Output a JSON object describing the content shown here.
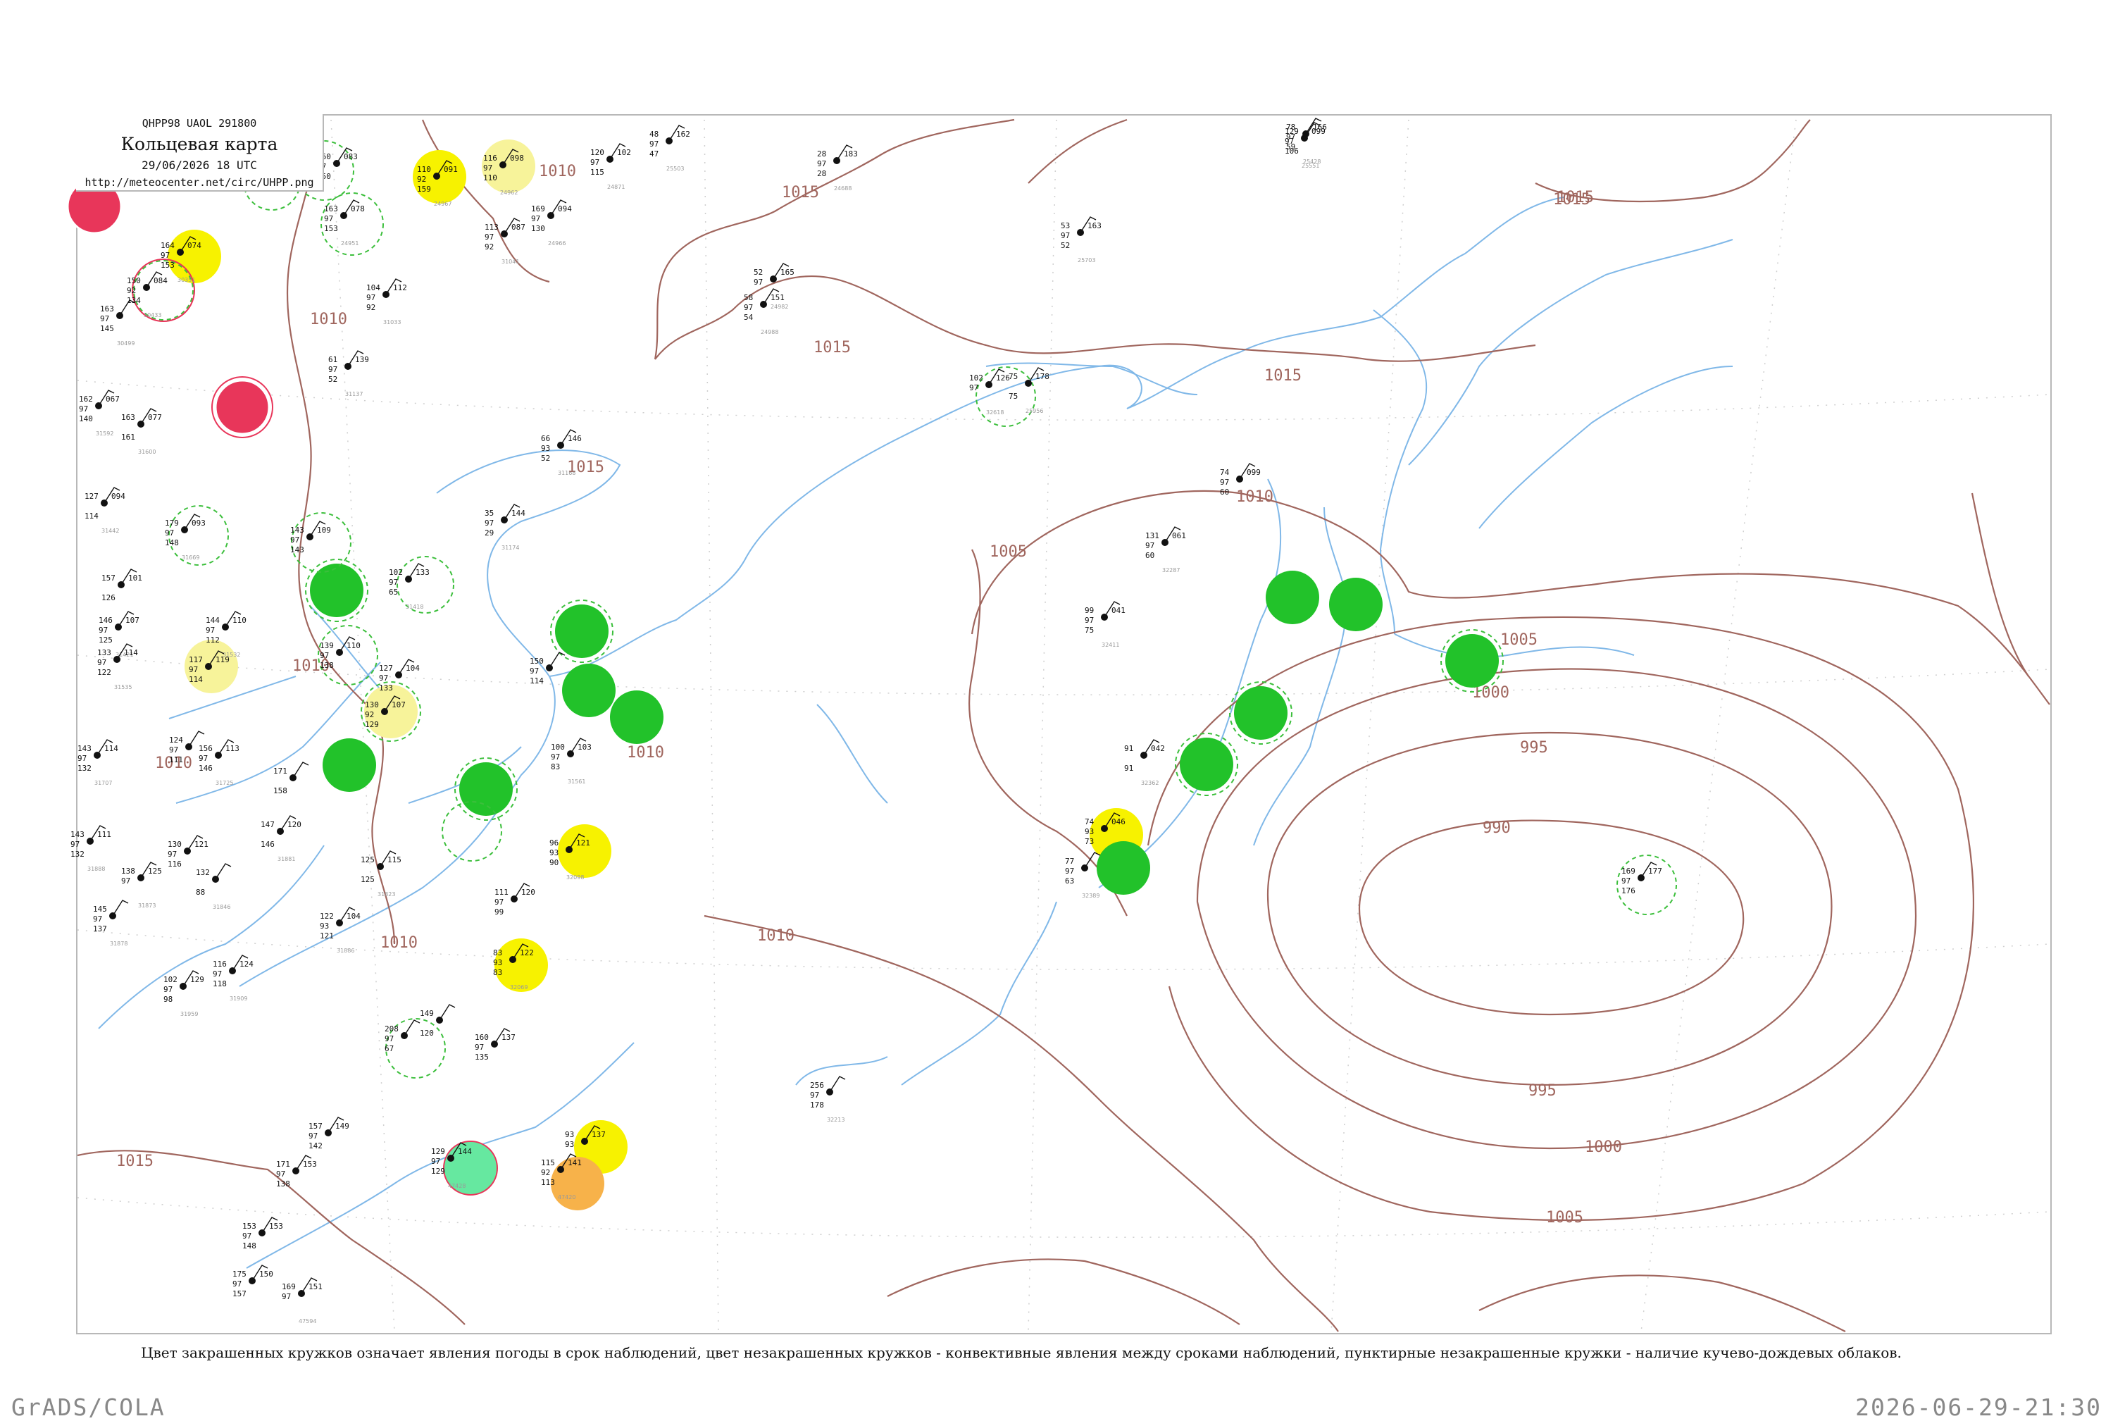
{
  "header": {
    "code": "QHPP98  UAOL  291800",
    "title": "Кольцевая карта",
    "date": "29/06/2026 18 UTC",
    "url": "http://meteocenter.net/circ/UHPP.png"
  },
  "caption": "Цвет закрашенных кружков означает явления погоды в срок наблюдений, цвет незакрашенных кружков - конвективные явления между сроками наблюдений, пунктирные незакрашенные кружки - наличие кучево-дождевых облаков.",
  "footer": {
    "left": "GrADS/COLA",
    "right": "2026-06-29-21:30"
  },
  "colors": {
    "isobar": "#a0665e",
    "coast": "#80b8e8",
    "frame": "#b8b8b8",
    "green": "#22c22a",
    "yellow": "#f7f200",
    "light_yellow": "#f7f39a",
    "red": "#e8365a",
    "orange": "#f7b24a",
    "teal": "#66e8a0"
  },
  "isobar_labels": [
    {
      "text": "1015"
    },
    {
      "text": "1015"
    },
    {
      "text": "1015"
    },
    {
      "text": "1015"
    },
    {
      "text": "1015"
    },
    {
      "text": "1015"
    },
    {
      "text": "1010"
    },
    {
      "text": "1010"
    },
    {
      "text": "1010"
    },
    {
      "text": "1010"
    },
    {
      "text": "1010"
    },
    {
      "text": "1010"
    },
    {
      "text": "1005"
    },
    {
      "text": "1005"
    },
    {
      "text": "1005"
    },
    {
      "text": "1000"
    },
    {
      "text": "1000"
    },
    {
      "text": "995"
    },
    {
      "text": "995"
    },
    {
      "text": "990"
    },
    {
      "text": "1010"
    },
    {
      "text": "1010"
    },
    {
      "text": "1015"
    }
  ],
  "stations": [
    {
      "id": "1",
      "t": "160",
      "p": "083",
      "v": "97",
      "w": "150",
      "wmo": ""
    },
    {
      "id": "2",
      "t": "110",
      "p": "091",
      "v": "92",
      "w": "159",
      "wmo": "24967"
    },
    {
      "id": "3",
      "t": "116",
      "p": "098",
      "v": "97",
      "w": "110",
      "wmo": "24962"
    },
    {
      "id": "4",
      "t": "120",
      "p": "102",
      "v": "97",
      "w": "115",
      "wmo": "24871"
    },
    {
      "id": "5",
      "t": "163",
      "p": "078",
      "v": "97",
      "w": "153",
      "wmo": "24951"
    },
    {
      "id": "6",
      "t": "169",
      "p": "094",
      "v": "97",
      "w": "130",
      "wmo": "24966"
    },
    {
      "id": "7",
      "t": "113",
      "p": "087",
      "v": "97",
      "w": "92",
      "wmo": "31041"
    },
    {
      "id": "8",
      "t": "164",
      "p": "074",
      "v": "97",
      "w": "153",
      "wmo": "30351"
    },
    {
      "id": "9",
      "t": "150",
      "p": "084",
      "v": "92",
      "w": "134",
      "wmo": "30433"
    },
    {
      "id": "10",
      "t": "163",
      "p": "",
      "v": "97",
      "w": "145",
      "wmo": "30499"
    },
    {
      "id": "11",
      "t": "104",
      "p": "112",
      "v": "97",
      "w": "92",
      "wmo": "31033"
    },
    {
      "id": "12",
      "t": "61",
      "p": "139",
      "v": "97",
      "w": "52",
      "wmo": "31137"
    },
    {
      "id": "13",
      "t": "162",
      "p": "067",
      "v": "97",
      "w": "140",
      "wmo": "31592"
    },
    {
      "id": "14",
      "t": "163",
      "p": "077",
      "v": "",
      "w": "161",
      "wmo": "31600"
    },
    {
      "id": "15",
      "t": "66",
      "p": "146",
      "v": "93",
      "w": "52",
      "wmo": "31168"
    },
    {
      "id": "16",
      "t": "127",
      "p": "094",
      "v": "",
      "w": "114",
      "wmo": "31442"
    },
    {
      "id": "17",
      "t": "179",
      "p": "093",
      "v": "97",
      "w": "148",
      "wmo": "31669"
    },
    {
      "id": "18",
      "t": "143",
      "p": "109",
      "v": "97",
      "w": "143",
      "wmo": ""
    },
    {
      "id": "19",
      "t": "35",
      "p": "144",
      "v": "97",
      "w": "29",
      "wmo": "31174"
    },
    {
      "id": "20",
      "t": "102",
      "p": "133",
      "v": "97",
      "w": "65",
      "wmo": "31418"
    },
    {
      "id": "21",
      "t": "157",
      "p": "101",
      "v": "",
      "w": "126",
      "wmo": ""
    },
    {
      "id": "22",
      "t": "146",
      "p": "107",
      "v": "97",
      "w": "125",
      "wmo": "31421"
    },
    {
      "id": "23",
      "t": "144",
      "p": "110",
      "v": "97",
      "w": "112",
      "wmo": "31532"
    },
    {
      "id": "24",
      "t": "133",
      "p": "114",
      "v": "97",
      "w": "122",
      "wmo": "31535"
    },
    {
      "id": "25",
      "t": "117",
      "p": "119",
      "v": "97",
      "w": "114",
      "wmo": ""
    },
    {
      "id": "26",
      "t": "139",
      "p": "110",
      "v": "97",
      "w": "138",
      "wmo": ""
    },
    {
      "id": "27",
      "t": "127",
      "p": "104",
      "v": "97",
      "w": "133",
      "wmo": ""
    },
    {
      "id": "28",
      "t": "130",
      "p": "107",
      "v": "92",
      "w": "129",
      "wmo": ""
    },
    {
      "id": "29",
      "t": "150",
      "p": "",
      "v": "97",
      "w": "114",
      "wmo": ""
    },
    {
      "id": "30",
      "t": "100",
      "p": "103",
      "v": "97",
      "w": "83",
      "wmo": "31561"
    },
    {
      "id": "31",
      "t": "143",
      "p": "114",
      "v": "97",
      "w": "132",
      "wmo": "31707"
    },
    {
      "id": "32",
      "t": "124",
      "p": "",
      "v": "97",
      "w": "111",
      "wmo": ""
    },
    {
      "id": "33",
      "t": "156",
      "p": "113",
      "v": "97",
      "w": "146",
      "wmo": "31725"
    },
    {
      "id": "34",
      "t": "171",
      "p": "",
      "v": "",
      "w": "158",
      "wmo": ""
    },
    {
      "id": "35",
      "t": "143",
      "p": "111",
      "v": "97",
      "w": "132",
      "wmo": "31888"
    },
    {
      "id": "36",
      "t": "130",
      "p": "121",
      "v": "97",
      "w": "116",
      "wmo": ""
    },
    {
      "id": "37",
      "t": "147",
      "p": "120",
      "v": "",
      "w": "146",
      "wmo": "31881"
    },
    {
      "id": "38",
      "t": "138",
      "p": "125",
      "v": "97",
      "w": "",
      "wmo": "31873"
    },
    {
      "id": "39",
      "t": "145",
      "p": "",
      "v": "97",
      "w": "137",
      "wmo": "31878"
    },
    {
      "id": "40",
      "t": "132",
      "p": "",
      "v": "",
      "w": "88",
      "wmo": "31846"
    },
    {
      "id": "41",
      "t": "122",
      "p": "104",
      "v": "93",
      "w": "121",
      "wmo": "31886"
    },
    {
      "id": "42",
      "t": "125",
      "p": "115",
      "v": "",
      "w": "125",
      "wmo": "31823"
    },
    {
      "id": "43",
      "t": "102",
      "p": "129",
      "v": "97",
      "w": "98",
      "wmo": "31959"
    },
    {
      "id": "44",
      "t": "116",
      "p": "124",
      "v": "97",
      "w": "118",
      "wmo": "31909"
    },
    {
      "id": "45",
      "t": "208",
      "p": "",
      "v": "97",
      "w": "67",
      "wmo": ""
    },
    {
      "id": "46",
      "t": "149",
      "p": "",
      "v": "",
      "w": "120",
      "wmo": ""
    },
    {
      "id": "47",
      "t": "160",
      "p": "137",
      "v": "97",
      "w": "135",
      "wmo": ""
    },
    {
      "id": "48",
      "t": "111",
      "p": "120",
      "v": "97",
      "w": "99",
      "wmo": ""
    },
    {
      "id": "49",
      "t": "83",
      "p": "122",
      "v": "93",
      "w": "83",
      "wmo": "32069"
    },
    {
      "id": "50",
      "t": "96",
      "p": "121",
      "v": "93",
      "w": "90",
      "wmo": "32098"
    },
    {
      "id": "51",
      "t": "131",
      "p": "061",
      "v": "97",
      "w": "60",
      "wmo": "32287"
    },
    {
      "id": "52",
      "t": "74",
      "p": "099",
      "v": "97",
      "w": "60",
      "wmo": ""
    },
    {
      "id": "53",
      "t": "99",
      "p": "041",
      "v": "97",
      "w": "75",
      "wmo": "32411"
    },
    {
      "id": "54",
      "t": "102",
      "p": "126",
      "v": "97",
      "w": "",
      "wmo": "32618"
    },
    {
      "id": "55",
      "t": "74",
      "p": "046",
      "v": "93",
      "w": "73",
      "wmo": ""
    },
    {
      "id": "56",
      "t": "77",
      "p": "",
      "v": "97",
      "w": "63",
      "wmo": "32389"
    },
    {
      "id": "57",
      "t": "91",
      "p": "042",
      "v": "",
      "w": "91",
      "wmo": "32362"
    },
    {
      "id": "58",
      "t": "169",
      "p": "177",
      "v": "97",
      "w": "176",
      "wmo": ""
    },
    {
      "id": "59",
      "t": "256",
      "p": "",
      "v": "97",
      "w": "178",
      "wmo": "32213"
    },
    {
      "id": "60",
      "t": "129",
      "p": "144",
      "v": "97",
      "w": "129",
      "wmo": "47428"
    },
    {
      "id": "61",
      "t": "93",
      "p": "137",
      "v": "93",
      "w": "",
      "wmo": ""
    },
    {
      "id": "62",
      "t": "115",
      "p": "141",
      "v": "92",
      "w": "113",
      "wmo": "47420"
    },
    {
      "id": "63",
      "t": "157",
      "p": "149",
      "v": "97",
      "w": "142",
      "wmo": ""
    },
    {
      "id": "64",
      "t": "171",
      "p": "153",
      "v": "97",
      "w": "138",
      "wmo": ""
    },
    {
      "id": "65",
      "t": "153",
      "p": "153",
      "v": "97",
      "w": "148",
      "wmo": ""
    },
    {
      "id": "66",
      "t": "175",
      "p": "150",
      "v": "97",
      "w": "157",
      "wmo": ""
    },
    {
      "id": "67",
      "t": "169",
      "p": "151",
      "v": "97",
      "w": "",
      "wmo": "47594"
    },
    {
      "id": "68",
      "t": "129",
      "p": "099",
      "v": "97",
      "w": "106",
      "wmo": "25551"
    },
    {
      "id": "69",
      "t": "78",
      "p": "166",
      "v": "97",
      "w": "59",
      "wmo": "25428"
    },
    {
      "id": "70",
      "t": "48",
      "p": "162",
      "v": "97",
      "w": "47",
      "wmo": "25503"
    },
    {
      "id": "71",
      "t": "53",
      "p": "163",
      "v": "97",
      "w": "52",
      "wmo": "25703"
    },
    {
      "id": "72",
      "t": "52",
      "p": "165",
      "v": "97",
      "w": "",
      "wmo": "24982"
    },
    {
      "id": "73",
      "t": "58",
      "p": "151",
      "v": "97",
      "w": "54",
      "wmo": "24988"
    },
    {
      "id": "74",
      "t": "28",
      "p": "183",
      "v": "97",
      "w": "28",
      "wmo": "24688"
    },
    {
      "id": "75",
      "t": "75",
      "p": "178",
      "v": "",
      "w": "75",
      "wmo": "25956"
    }
  ]
}
